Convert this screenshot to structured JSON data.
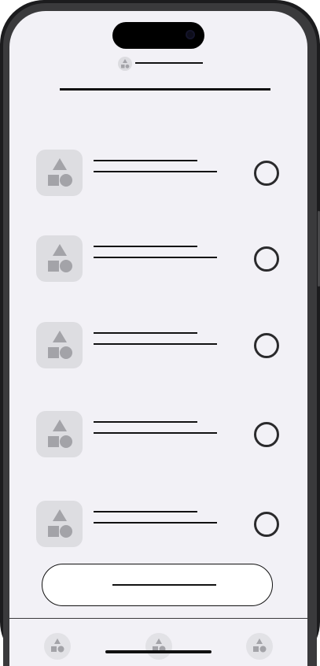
{
  "app": {
    "header_icon": "shapes-icon",
    "header_title": "",
    "page_title": ""
  },
  "list": {
    "items": [
      {
        "title": "",
        "subtitle": "",
        "icon": "shapes-icon",
        "selected": false
      },
      {
        "title": "",
        "subtitle": "",
        "icon": "shapes-icon",
        "selected": false
      },
      {
        "title": "",
        "subtitle": "",
        "icon": "shapes-icon",
        "selected": false
      },
      {
        "title": "",
        "subtitle": "",
        "icon": "shapes-icon",
        "selected": false
      },
      {
        "title": "",
        "subtitle": "",
        "icon": "shapes-icon",
        "selected": false
      }
    ]
  },
  "primary_button": {
    "label": ""
  },
  "tabbar": {
    "tabs": [
      {
        "icon": "shapes-icon",
        "label": ""
      },
      {
        "icon": "shapes-icon",
        "label": ""
      },
      {
        "icon": "shapes-icon",
        "label": ""
      }
    ]
  },
  "colors": {
    "screen_background": "#f2f1f6",
    "placeholder_gray": "#dddde1",
    "ink": "#111111"
  }
}
